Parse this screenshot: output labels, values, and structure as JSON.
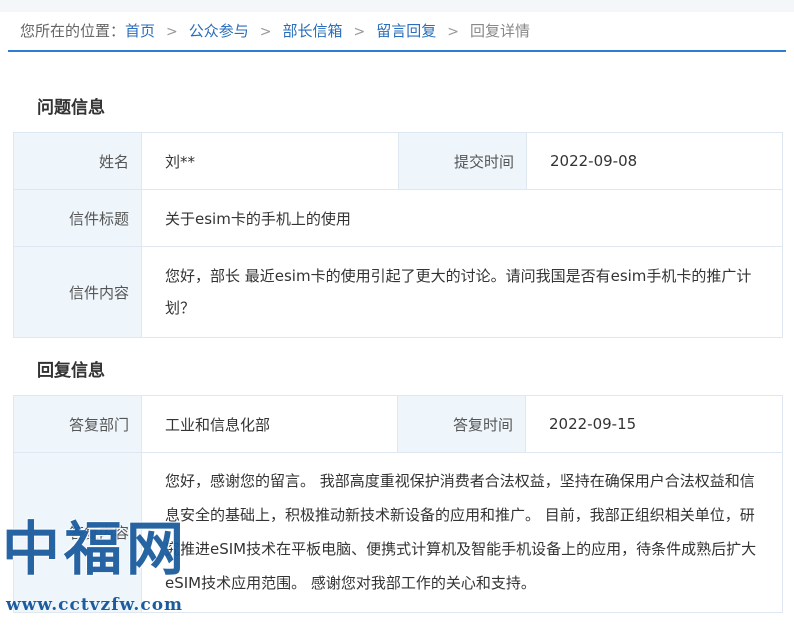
{
  "breadcrumb": {
    "lead": "您所在的位置：",
    "items": [
      "首页",
      "公众参与",
      "部长信箱",
      "留言回复"
    ],
    "current": "回复详情",
    "separator": ">"
  },
  "question": {
    "section_title": "问题信息",
    "name_label": "姓名",
    "name_value": "刘**",
    "submit_time_label": "提交时间",
    "submit_time_value": "2022-09-08",
    "subject_label": "信件标题",
    "subject_value": "关于esim卡的手机上的使用",
    "content_label": "信件内容",
    "content_value": "您好，部长 最近esim卡的使用引起了更大的讨论。请问我国是否有esim手机卡的推广计划？"
  },
  "reply": {
    "section_title": "回复信息",
    "department_label": "答复部门",
    "department_value": "工业和信息化部",
    "reply_time_label": "答复时间",
    "reply_time_value": "2022-09-15",
    "content_label": "答复内容",
    "content_value": "您好，感谢您的留言。 我部高度重视保护消费者合法权益，坚持在确保用户合法权益和信息安全的基础上，积极推动新技术新设备的应用和推广。 目前，我部正组织相关单位，研究推进eSIM技术在平板电脑、便携式计算机及智能手机设备上的应用，待条件成熟后扩大eSIM技术应用范围。 感谢您对我部工作的关心和支持。"
  },
  "watermark": {
    "chars": "中福网",
    "url": "www.cctvzfw.com"
  },
  "colors": {
    "link": "#2a6ebb",
    "accent_line": "#2a7fd4",
    "label_bg": "#eef5fb",
    "border": "#dfe7f0",
    "watermark": "#1c5c9e"
  }
}
